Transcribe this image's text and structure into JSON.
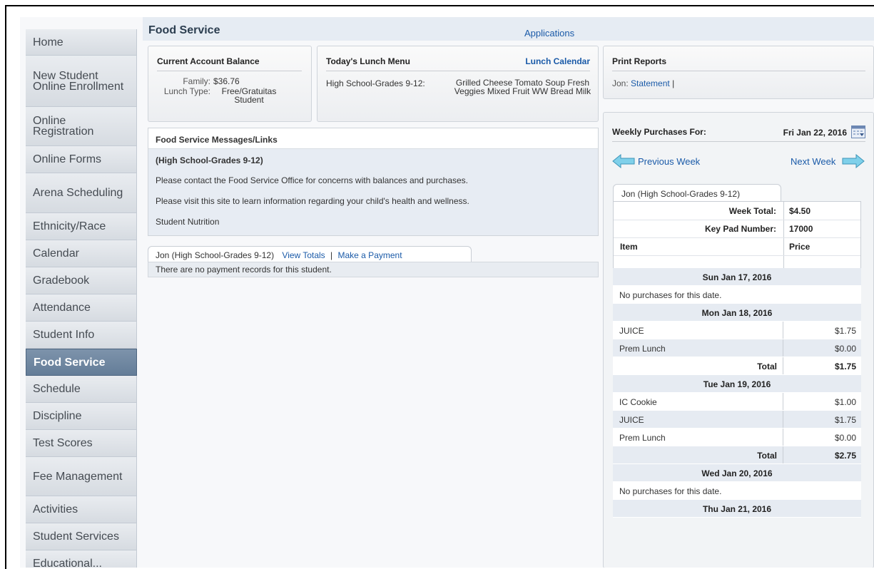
{
  "sidebar": {
    "items": [
      {
        "label": "Home"
      },
      {
        "label": "New Student Online Enrollment"
      },
      {
        "label": "Online Registration"
      },
      {
        "label": "Online Forms"
      },
      {
        "label": "Arena Scheduling"
      },
      {
        "label": "Ethnicity/Race"
      },
      {
        "label": "Calendar"
      },
      {
        "label": "Gradebook"
      },
      {
        "label": "Attendance"
      },
      {
        "label": "Student Info"
      },
      {
        "label": "Food Service"
      },
      {
        "label": "Schedule"
      },
      {
        "label": "Discipline"
      },
      {
        "label": "Test Scores"
      },
      {
        "label": "Fee Management"
      },
      {
        "label": "Activities"
      },
      {
        "label": "Student Services"
      },
      {
        "label": "Educational..."
      }
    ],
    "active": "Food Service"
  },
  "header": {
    "title": "Food Service",
    "applications_link": "Applications"
  },
  "balance": {
    "heading": "Current Account Balance",
    "family_label": "Family:",
    "family_value": "$36.76",
    "lunch_label": "Lunch Type:",
    "lunch_value": "Free/Gratuitas Student"
  },
  "menu": {
    "heading": "Today's Lunch Menu",
    "calendar_link": "Lunch Calendar",
    "grade_label": "High School-Grades 9-12:",
    "items": "Grilled Cheese Tomato Soup Fresh Veggies Mixed Fruit WW Bread Milk"
  },
  "reports": {
    "heading": "Print Reports",
    "student": "Jon:",
    "statement_link": "Statement",
    "separator": "|"
  },
  "messages": {
    "heading": "Food Service Messages/Links",
    "grade_heading": "(High School-Grades 9-12)",
    "line1": "Please contact the Food Service Office for concerns with balances and purchases.",
    "line2": "Please visit this site to learn information regarding your child's health and wellness.",
    "link": "Student Nutrition"
  },
  "payments": {
    "tab_label": "Jon (High School-Grades 9-12)",
    "view_totals": "View Totals",
    "separator": "|",
    "make_payment": "Make a Payment",
    "empty": "There are no payment records for this student."
  },
  "weekly": {
    "heading": "Weekly Purchases For:",
    "date": "Fri Jan 22, 2016",
    "prev": "Previous Week",
    "next": "Next Week",
    "tab_label": "Jon (High School-Grades 9-12)",
    "week_total_label": "Week Total:",
    "week_total": "$4.50",
    "keypad_label": "Key Pad Number:",
    "keypad": "17000",
    "col_item": "Item",
    "col_price": "Price",
    "rows": [
      {
        "type": "date",
        "label": "Sun Jan 17, 2016"
      },
      {
        "type": "note",
        "label": "No purchases for this date."
      },
      {
        "type": "date",
        "label": "Mon Jan 18, 2016"
      },
      {
        "type": "item",
        "label": "JUICE",
        "price": "$1.75"
      },
      {
        "type": "item",
        "label": "Prem Lunch",
        "price": "$0.00"
      },
      {
        "type": "total",
        "label": "Total",
        "price": "$1.75"
      },
      {
        "type": "date",
        "label": "Tue Jan 19, 2016"
      },
      {
        "type": "item",
        "label": "IC Cookie",
        "price": "$1.00"
      },
      {
        "type": "item",
        "label": "JUICE",
        "price": "$1.75"
      },
      {
        "type": "item",
        "label": "Prem Lunch",
        "price": "$0.00"
      },
      {
        "type": "total",
        "label": "Total",
        "price": "$2.75"
      },
      {
        "type": "date",
        "label": "Wed Jan 20, 2016"
      },
      {
        "type": "note",
        "label": "No purchases for this date."
      },
      {
        "type": "date",
        "label": "Thu Jan 21, 2016"
      }
    ]
  }
}
